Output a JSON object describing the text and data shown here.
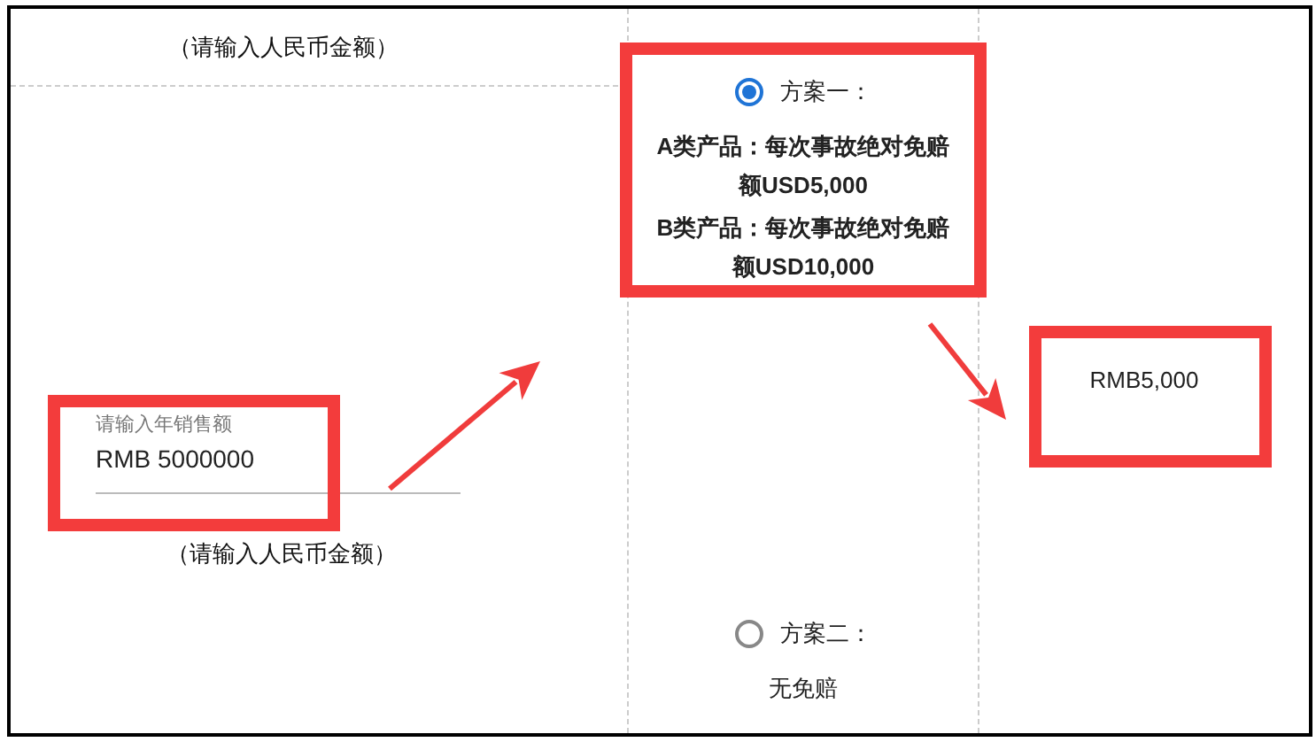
{
  "sales_input": {
    "hint_top": "（请输入人民币金额）",
    "label": "请输入年销售额",
    "value": "RMB 5000000",
    "note": "（请输入人民币金额）"
  },
  "plans": [
    {
      "label": "方案一：",
      "selected": true,
      "descriptions": [
        "A类产品：每次事故绝对免赔额USD5,000",
        "B类产品：每次事故绝对免赔额USD10,000"
      ]
    },
    {
      "label": "方案二：",
      "selected": false,
      "descriptions": [
        "无免赔"
      ]
    }
  ],
  "result": "RMB5,000"
}
